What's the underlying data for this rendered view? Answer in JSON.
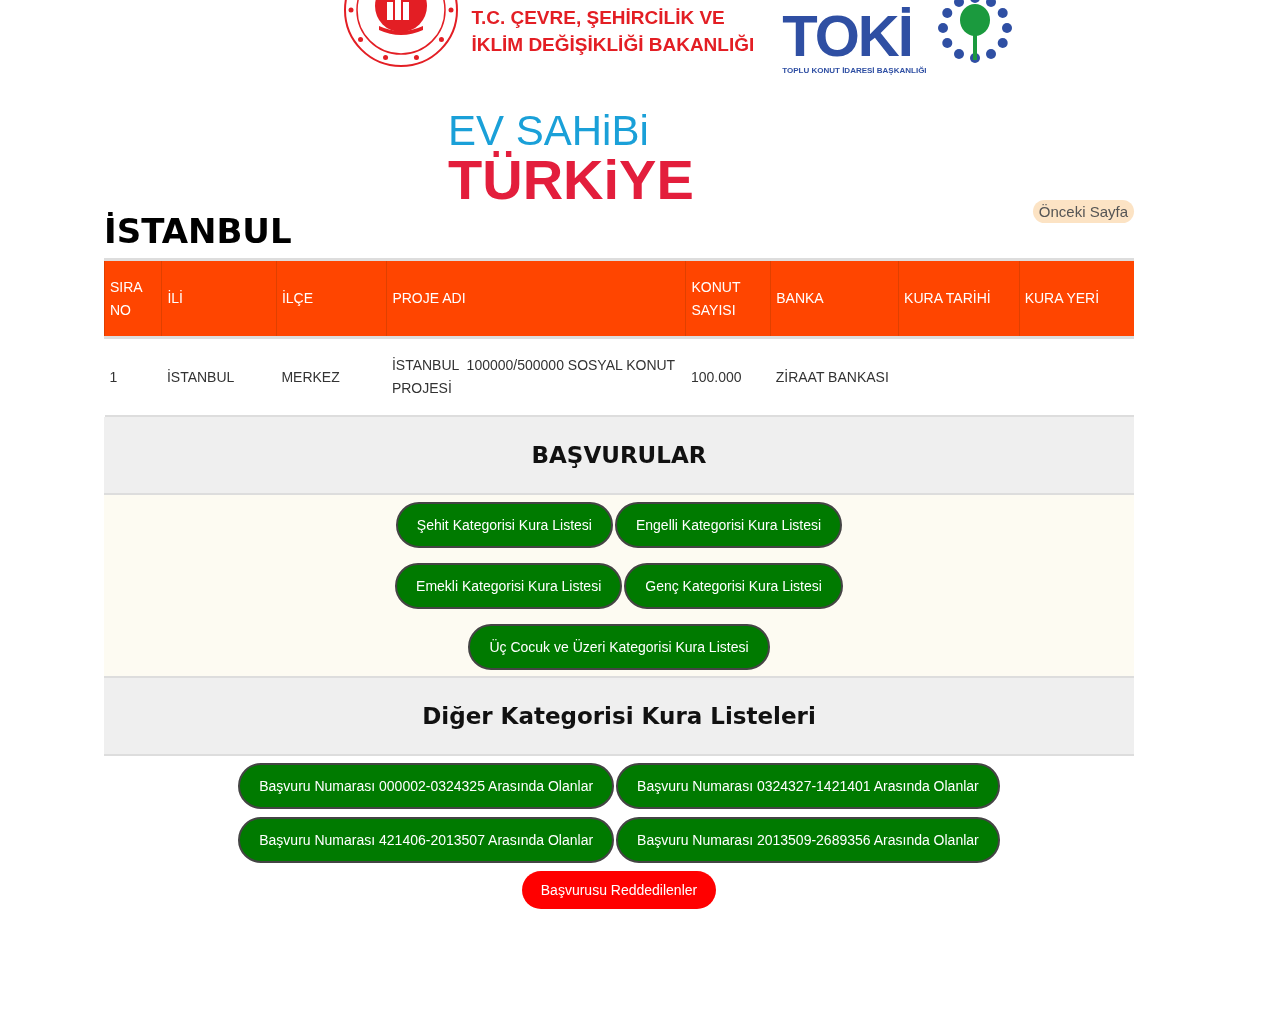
{
  "header": {
    "ministry_lines": [
      "T.C. ÇEVRE, ŞEHİRCİLİK VE",
      "İKLİM DEĞİŞİKLİĞİ BAKANLIĞI"
    ],
    "toki_name": "TOKİ",
    "toki_subtitle": "TOPLU KONUT İDARESİ BAŞKANLIĞI",
    "campaign_line_1": "EV SAHiBi",
    "campaign_line_2": "TÜRKiYE"
  },
  "back_link": "Önceki Sayfa",
  "city_title": "İSTANBUL",
  "table": {
    "columns": [
      "SIRA NO",
      "İLİ",
      "İLÇE",
      "PROJE ADI",
      "KONUT SAYISI",
      "BANKA",
      "KURA TARİHİ",
      "KURA YERİ"
    ],
    "rows": [
      [
        "1",
        "İSTANBUL",
        "MERKEZ",
        "İSTANBUL  100000/500000 SOSYAL KONUT PROJESİ",
        "100.000",
        "ZİRAAT BANKASI",
        "",
        ""
      ]
    ]
  },
  "sections": [
    {
      "title": "BAŞVURULAR",
      "rows": [
        [
          {
            "label": "Şehit Kategorisi Kura Listesi",
            "kind": "green"
          },
          {
            "label": "Engelli Kategorisi Kura Listesi",
            "kind": "green"
          }
        ],
        [
          {
            "label": "Emekli Kategorisi Kura Listesi",
            "kind": "green"
          },
          {
            "label": "Genç Kategorisi Kura Listesi",
            "kind": "green"
          }
        ],
        [
          {
            "label": "Üç Cocuk ve Üzeri Kategorisi Kura Listesi",
            "kind": "green"
          }
        ]
      ]
    },
    {
      "title": "Diğer Kategorisi Kura Listeleri",
      "rows": [
        [
          {
            "label": "Başvuru Numarası 000002-0324325 Arasında Olanlar",
            "kind": "green"
          },
          {
            "label": "Başvuru Numarası 0324327-1421401 Arasında Olanlar",
            "kind": "green"
          }
        ],
        [
          {
            "label": "Başvuru Numarası 421406-2013507 Arasında Olanlar",
            "kind": "green"
          },
          {
            "label": "Başvuru Numarası 2013509-2689356 Arasında Olanlar",
            "kind": "green"
          }
        ],
        [
          {
            "label": "Başvurusu Reddedilenler",
            "kind": "red"
          }
        ]
      ]
    }
  ]
}
